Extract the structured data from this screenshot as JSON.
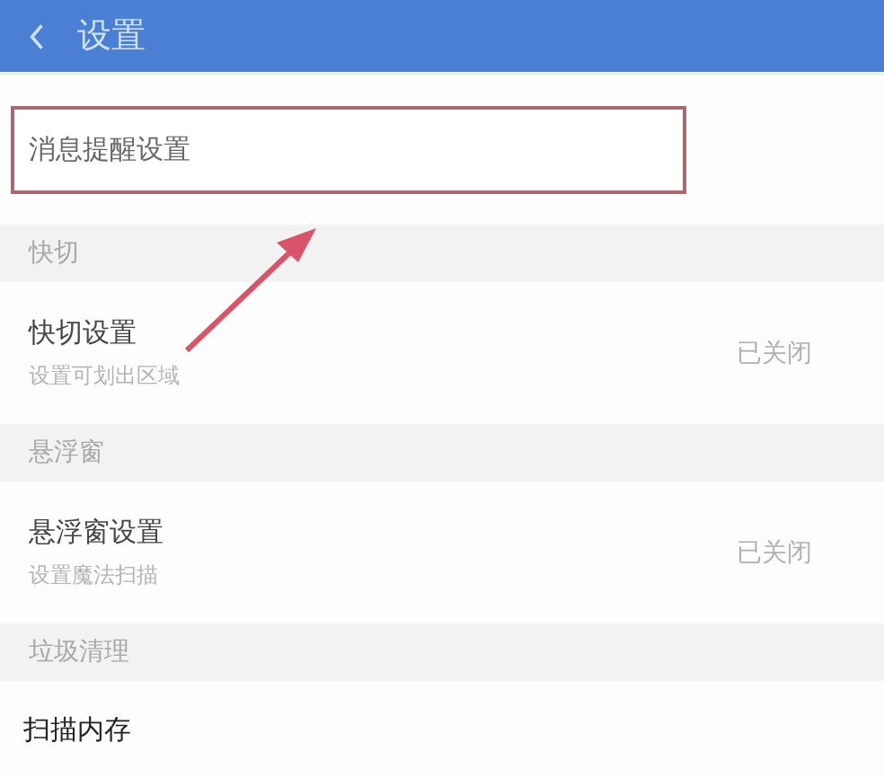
{
  "header": {
    "title": "设置"
  },
  "sections": [
    {
      "items": [
        {
          "kind": "highlighted",
          "title": "消息提醒设置"
        }
      ]
    },
    {
      "heading": "快切",
      "items": [
        {
          "kind": "setting",
          "title": "快切设置",
          "subtitle": "设置可划出区域",
          "value": "已关闭"
        }
      ]
    },
    {
      "heading": "悬浮窗",
      "items": [
        {
          "kind": "setting",
          "title": "悬浮窗设置",
          "subtitle": "设置魔法扫描",
          "value": "已关闭"
        }
      ]
    },
    {
      "heading": "垃圾清理",
      "items": [
        {
          "kind": "plain",
          "title": "扫描内存"
        }
      ]
    }
  ]
}
